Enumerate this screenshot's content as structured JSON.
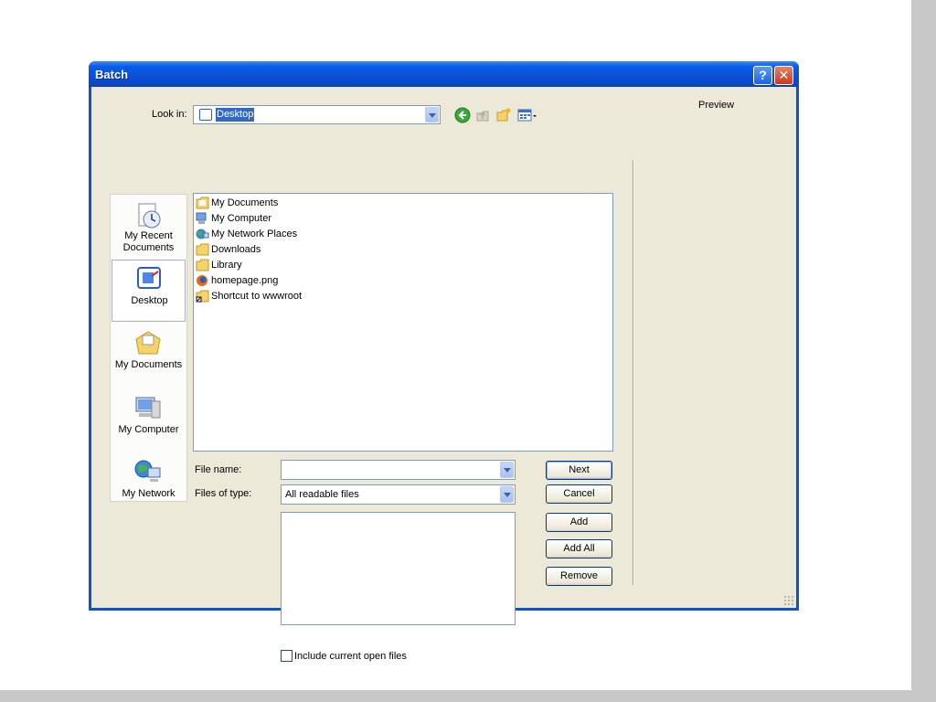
{
  "window": {
    "title": "Batch"
  },
  "look_in": {
    "label": "Look in:",
    "value": "Desktop"
  },
  "toolbar": {
    "back_icon": "back-icon",
    "up_icon": "up-folder-icon",
    "new_folder_icon": "new-folder-icon",
    "views_icon": "views-menu-icon"
  },
  "places": [
    {
      "label": "My Recent Documents",
      "icon": "recent-documents-icon"
    },
    {
      "label": "Desktop",
      "icon": "desktop-icon",
      "selected": true
    },
    {
      "label": "My Documents",
      "icon": "my-documents-icon"
    },
    {
      "label": "My Computer",
      "icon": "my-computer-icon"
    },
    {
      "label": "My Network",
      "icon": "my-network-icon"
    }
  ],
  "files": [
    {
      "name": "My Documents",
      "icon": "documents-folder-icon"
    },
    {
      "name": "My Computer",
      "icon": "computer-icon"
    },
    {
      "name": "My Network Places",
      "icon": "network-icon"
    },
    {
      "name": "Downloads",
      "icon": "folder-icon"
    },
    {
      "name": "Library",
      "icon": "folder-icon"
    },
    {
      "name": "homepage.png",
      "icon": "firefox-file-icon"
    },
    {
      "name": "Shortcut to wwwroot",
      "icon": "shortcut-folder-icon"
    }
  ],
  "file_name": {
    "label": "File name:",
    "value": ""
  },
  "files_of_type": {
    "label": "Files of type:",
    "value": "All readable files"
  },
  "buttons": {
    "next": "Next",
    "cancel": "Cancel",
    "add": "Add",
    "add_all": "Add All",
    "remove": "Remove"
  },
  "include_open": {
    "label": "Include current open files",
    "checked": false
  },
  "preview": {
    "label": "Preview"
  },
  "colors": {
    "titlebar": "#0a52d6",
    "face": "#ece9d8",
    "selection": "#316ac5"
  }
}
